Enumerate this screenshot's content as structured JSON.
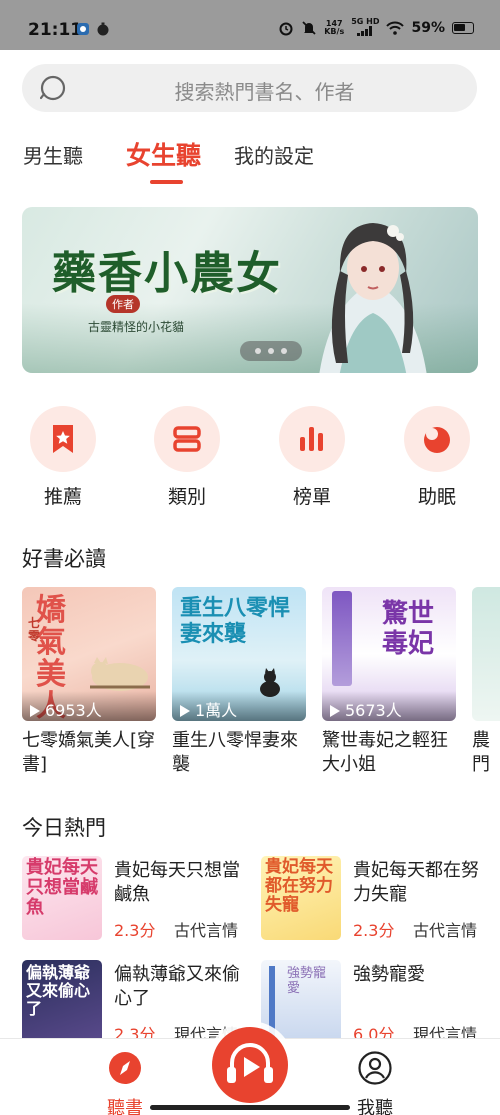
{
  "status_bar": {
    "time": "21:11",
    "net_speed_value": "147",
    "net_speed_unit": "KB/s",
    "signal": "5G HD",
    "battery": "59%"
  },
  "search": {
    "placeholder": "搜索熱門書名、作者"
  },
  "tabs": [
    {
      "label": "男生聽",
      "active": false
    },
    {
      "label": "女生聽",
      "active": true
    },
    {
      "label": "我的設定",
      "active": false
    }
  ],
  "banner": {
    "title": "藥香小農女",
    "author_tag": "作者",
    "author": "古靈精怪的小花貓"
  },
  "categories": [
    {
      "label": "推薦",
      "icon": "bookmark-star-icon"
    },
    {
      "label": "類別",
      "icon": "category-icon"
    },
    {
      "label": "榜單",
      "icon": "chart-bars-icon"
    },
    {
      "label": "助眠",
      "icon": "moon-icon"
    }
  ],
  "must_read": {
    "title": "好書必讀",
    "books": [
      {
        "cover_text": "嬌氣美人",
        "cover_side": "七零",
        "count": "6953人",
        "name": "七零嬌氣美人[穿書]"
      },
      {
        "cover_text": "重生八零悍妻來襲",
        "count": "1萬人",
        "name": "重生八零悍妻來襲"
      },
      {
        "cover_text": "驚世毒妃",
        "count": "5673人",
        "name": "驚世毒妃之輕狂大小姐"
      },
      {
        "name": "農門"
      }
    ]
  },
  "today_hot": {
    "title": "今日熱門",
    "items": [
      {
        "title": "貴妃每天只想當鹹魚",
        "score": "2.3分",
        "genre": "古代言情"
      },
      {
        "title": "貴妃每天都在努力失寵",
        "score": "2.3分",
        "genre": "古代言情"
      },
      {
        "title": "偏執薄爺又來偷心了",
        "score": "2.3分",
        "genre": "現代言情"
      },
      {
        "title": "強勢寵愛",
        "score": "6.0分",
        "genre": "現代言情"
      }
    ]
  },
  "bottom_nav": {
    "items": [
      {
        "label": "聽書",
        "active": true
      },
      {
        "label": "我聽",
        "active": false
      }
    ]
  },
  "colors": {
    "accent": "#e8432f",
    "accent_light": "#fde9e4"
  }
}
